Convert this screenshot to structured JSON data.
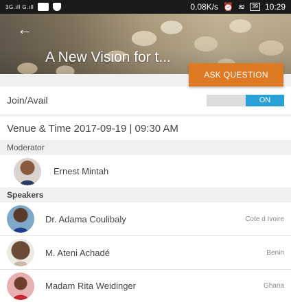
{
  "status_bar": {
    "network": "3G.ıll  G.ıll",
    "speed": "0.08K/s",
    "battery": "39",
    "time": "10:29"
  },
  "event": {
    "title": "A New Vision for t...",
    "ask_label": "ASK QUESTION"
  },
  "join": {
    "label": "Join/Avail",
    "toggle_state": "ON"
  },
  "venue": {
    "text": "Venue & Time  2017-09-19  |  09:30 AM"
  },
  "moderator": {
    "header": "Moderator",
    "name": "Ernest Mintah"
  },
  "speakers": {
    "header": "Speakers",
    "items": [
      {
        "name": "Dr. Adama  Coulibaly",
        "country": "Cote d Ivoire"
      },
      {
        "name": "M. Ateni Achadé",
        "country": "Benin"
      },
      {
        "name": "Madam Rita  Weidinger",
        "country": "Ghana"
      }
    ]
  },
  "colors": {
    "accent": "#de7a24",
    "toggle_on": "#29a1d8"
  }
}
